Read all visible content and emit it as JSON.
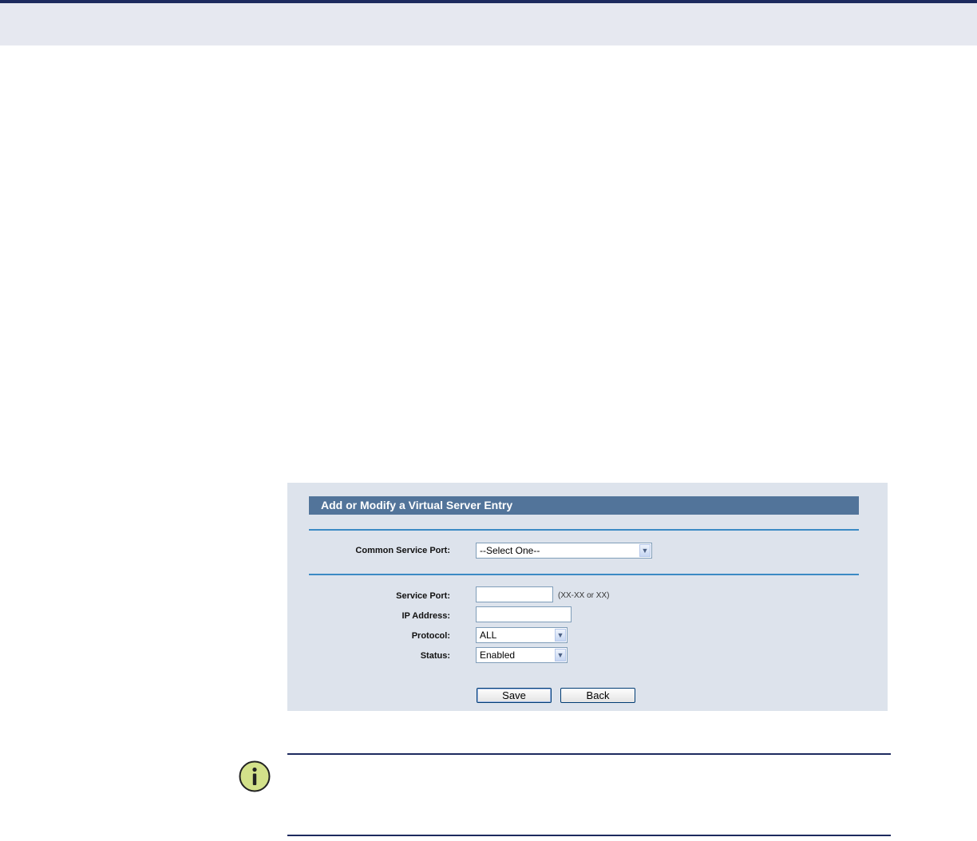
{
  "form": {
    "title": "Add or Modify a Virtual Server Entry",
    "common_service_port": {
      "label": "Common Service Port:",
      "value": "--Select One--"
    },
    "service_port": {
      "label": "Service Port:",
      "value": "",
      "hint": "(XX-XX or XX)"
    },
    "ip_address": {
      "label": "IP Address:",
      "value": ""
    },
    "protocol": {
      "label": "Protocol:",
      "value": "ALL"
    },
    "status": {
      "label": "Status:",
      "value": "Enabled"
    },
    "save_label": "Save",
    "back_label": "Back"
  },
  "colors": {
    "header_bg": "#52749a",
    "panel_bg": "#dde3ec",
    "divider": "#3b8ac4",
    "top_border": "#1d2a5e",
    "info_icon": "#d3e18a"
  },
  "icons": {
    "note": "info-icon"
  }
}
